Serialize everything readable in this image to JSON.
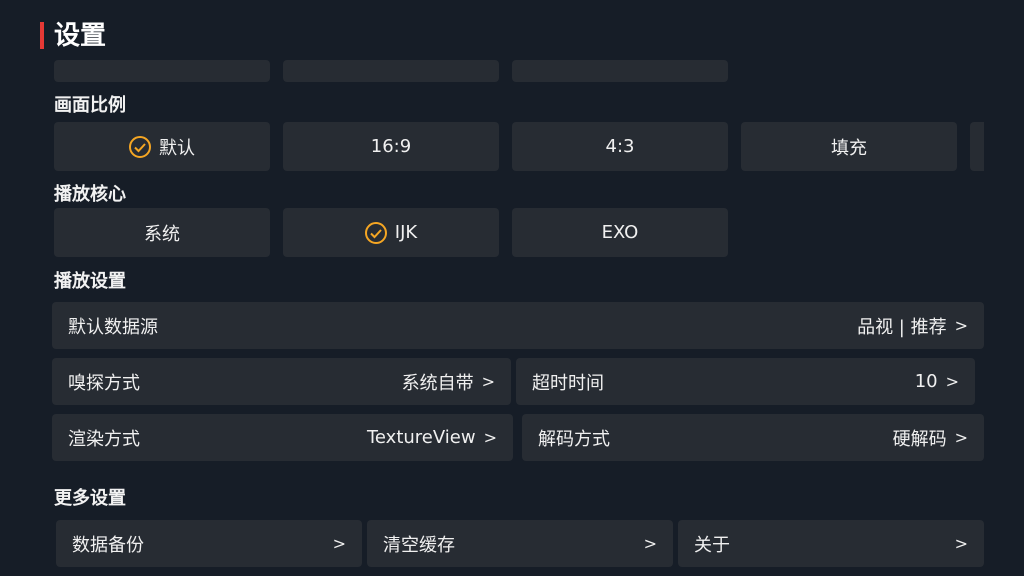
{
  "header": {
    "title": "设置",
    "accent_color": "#e53935"
  },
  "aspect_ratio": {
    "label": "画面比例",
    "options": [
      "默认",
      "16:9",
      "4:3",
      "填充"
    ],
    "selected": "默认"
  },
  "player_core": {
    "label": "播放核心",
    "options": [
      "系统",
      "IJK",
      "EXO"
    ],
    "selected": "IJK"
  },
  "playback": {
    "label": "播放设置",
    "default_source": {
      "label": "默认数据源",
      "value": "品视 | 推荐",
      "chevron": ">"
    },
    "sniff_mode": {
      "label": "嗅探方式",
      "value": "系统自带",
      "chevron": ">"
    },
    "timeout": {
      "label": "超时时间",
      "value": "10",
      "chevron": ">"
    },
    "render_mode": {
      "label": "渲染方式",
      "value": "TextureView",
      "chevron": ">"
    },
    "decode_mode": {
      "label": "解码方式",
      "value": "硬解码",
      "chevron": ">"
    }
  },
  "more": {
    "label": "更多设置",
    "items": [
      {
        "label": "数据备份",
        "chevron": ">"
      },
      {
        "label": "清空缓存",
        "chevron": ">"
      },
      {
        "label": "关于",
        "chevron": ">"
      }
    ]
  },
  "colors": {
    "background": "#161d27",
    "tile": "#272c33",
    "check": "#f5a623"
  }
}
